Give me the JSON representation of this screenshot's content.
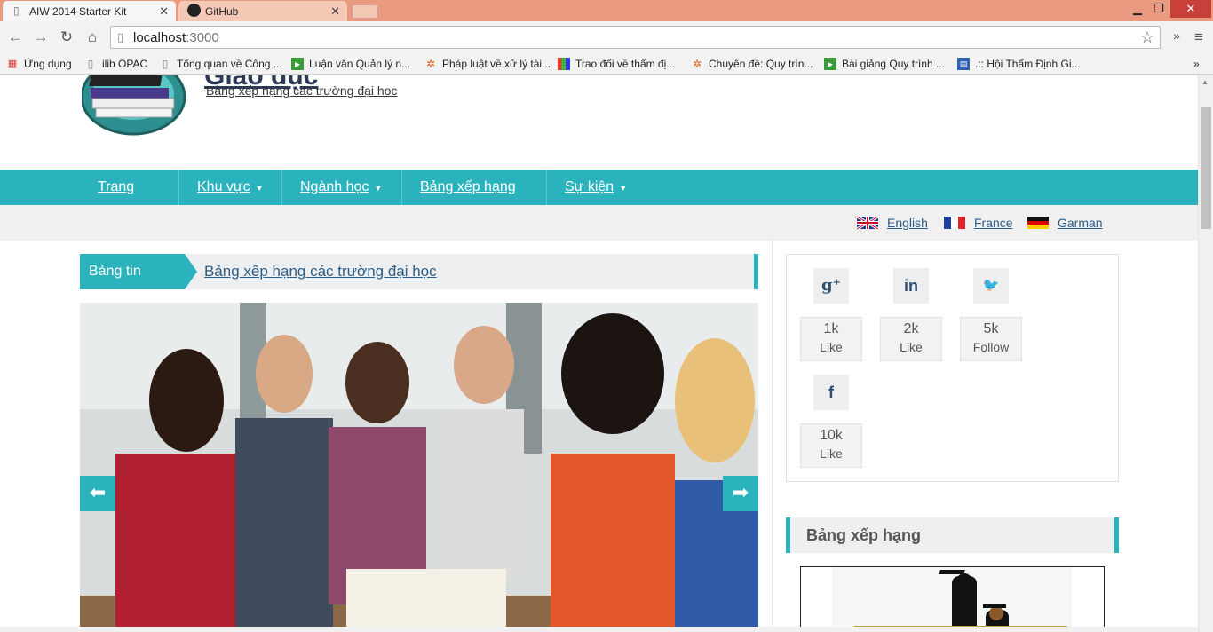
{
  "browser": {
    "tabs": [
      {
        "title": "AIW 2014 Starter Kit",
        "active": true
      },
      {
        "title": "GitHub",
        "active": false
      }
    ],
    "url_host": "localhost",
    "url_port": ":3000",
    "bookmarks": [
      {
        "label": "Ứng dụng",
        "icon": "apps-grid-icon"
      },
      {
        "label": "ilib OPAC",
        "icon": "page-icon"
      },
      {
        "label": "Tổng quan về Công ...",
        "icon": "page-icon"
      },
      {
        "label": "Luận văn Quản lý n...",
        "icon": "green-doc-icon"
      },
      {
        "label": "Pháp luật về xử lý tài...",
        "icon": "orange-star-icon"
      },
      {
        "label": "Trao đổi về thẩm đị...",
        "icon": "color-grid-icon"
      },
      {
        "label": "Chuyên đề: Quy trìn...",
        "icon": "orange-star-icon"
      },
      {
        "label": "Bài giảng Quy trình ...",
        "icon": "green-doc-icon"
      },
      {
        "label": ".:: Hội Thẩm Định Gi...",
        "icon": "site-icon"
      }
    ],
    "overflow": "»"
  },
  "site": {
    "title": "Giáo dục",
    "subtitle": "Bảng xếp hạng các trường đại hoc"
  },
  "nav": {
    "items": [
      {
        "label": "Trang chủ",
        "dropdown": false
      },
      {
        "label": "Khu vực",
        "dropdown": true
      },
      {
        "label": "Ngành học",
        "dropdown": true
      },
      {
        "label": "Bảng xếp hạng",
        "dropdown": true
      },
      {
        "label": "Sự kiện",
        "dropdown": true
      }
    ]
  },
  "languages": [
    {
      "label": "English",
      "flag": "uk-flag-icon"
    },
    {
      "label": "France",
      "flag": "france-flag-icon"
    },
    {
      "label": "Garman",
      "flag": "germany-flag-icon"
    }
  ],
  "news": {
    "label": "Bảng tin",
    "headline": "Bảng xếp hạng các trường đại học"
  },
  "social": [
    {
      "icon": "google-plus-icon",
      "glyph": "g⁺",
      "count": "1k",
      "action": "Like"
    },
    {
      "icon": "linkedin-icon",
      "glyph": "in",
      "count": "2k",
      "action": "Like"
    },
    {
      "icon": "twitter-icon",
      "glyph": "🐦",
      "count": "5k",
      "action": "Follow"
    },
    {
      "icon": "facebook-icon",
      "glyph": "f",
      "count": "10k",
      "action": "Like"
    }
  ],
  "ranking": {
    "title": "Bảng xếp hạng"
  },
  "colors": {
    "accent": "#2ab3bd",
    "link": "#2d5e87",
    "tabstrip": "#ea9a80"
  }
}
